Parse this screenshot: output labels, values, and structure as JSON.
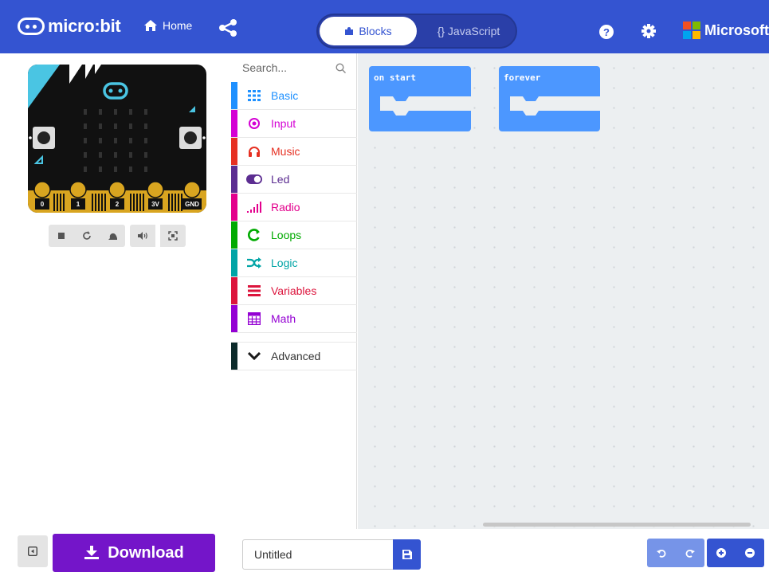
{
  "header": {
    "brand": "micro:bit",
    "home_label": "Home",
    "modes": {
      "blocks": "Blocks",
      "javascript": "{} JavaScript"
    },
    "help_label": "?",
    "microsoft_label": "Microsoft",
    "accent": "#3454d1"
  },
  "simulator": {
    "pins": [
      "0",
      "1",
      "2",
      "3V",
      "GND"
    ],
    "button_a": "A",
    "button_b": "B",
    "controls": [
      "stop-icon",
      "restart-icon",
      "slowmo-icon",
      "mute-icon",
      "fullscreen-icon"
    ]
  },
  "toolbox": {
    "search_placeholder": "Search...",
    "categories": [
      {
        "label": "Basic",
        "color": "#1e90ff",
        "icon": "grid-icon"
      },
      {
        "label": "Input",
        "color": "#d400d4",
        "icon": "target-icon"
      },
      {
        "label": "Music",
        "color": "#e63022",
        "icon": "headphones-icon"
      },
      {
        "label": "Led",
        "color": "#5c2d91",
        "icon": "toggle-icon"
      },
      {
        "label": "Radio",
        "color": "#e3008c",
        "icon": "signal-icon"
      },
      {
        "label": "Loops",
        "color": "#00aa00",
        "icon": "loop-icon"
      },
      {
        "label": "Logic",
        "color": "#00a4a6",
        "icon": "shuffle-icon"
      },
      {
        "label": "Variables",
        "color": "#dc143c",
        "icon": "list-icon"
      },
      {
        "label": "Math",
        "color": "#9400d3",
        "icon": "calculator-icon"
      }
    ],
    "advanced_label": "Advanced",
    "advanced_color": "#0b2a2a"
  },
  "workspace": {
    "blocks": [
      {
        "label": "on start"
      },
      {
        "label": "forever"
      }
    ],
    "block_color": "#4c97ff"
  },
  "footer": {
    "download_label": "Download",
    "project_name": "Untitled",
    "download_color": "#7415c9"
  }
}
